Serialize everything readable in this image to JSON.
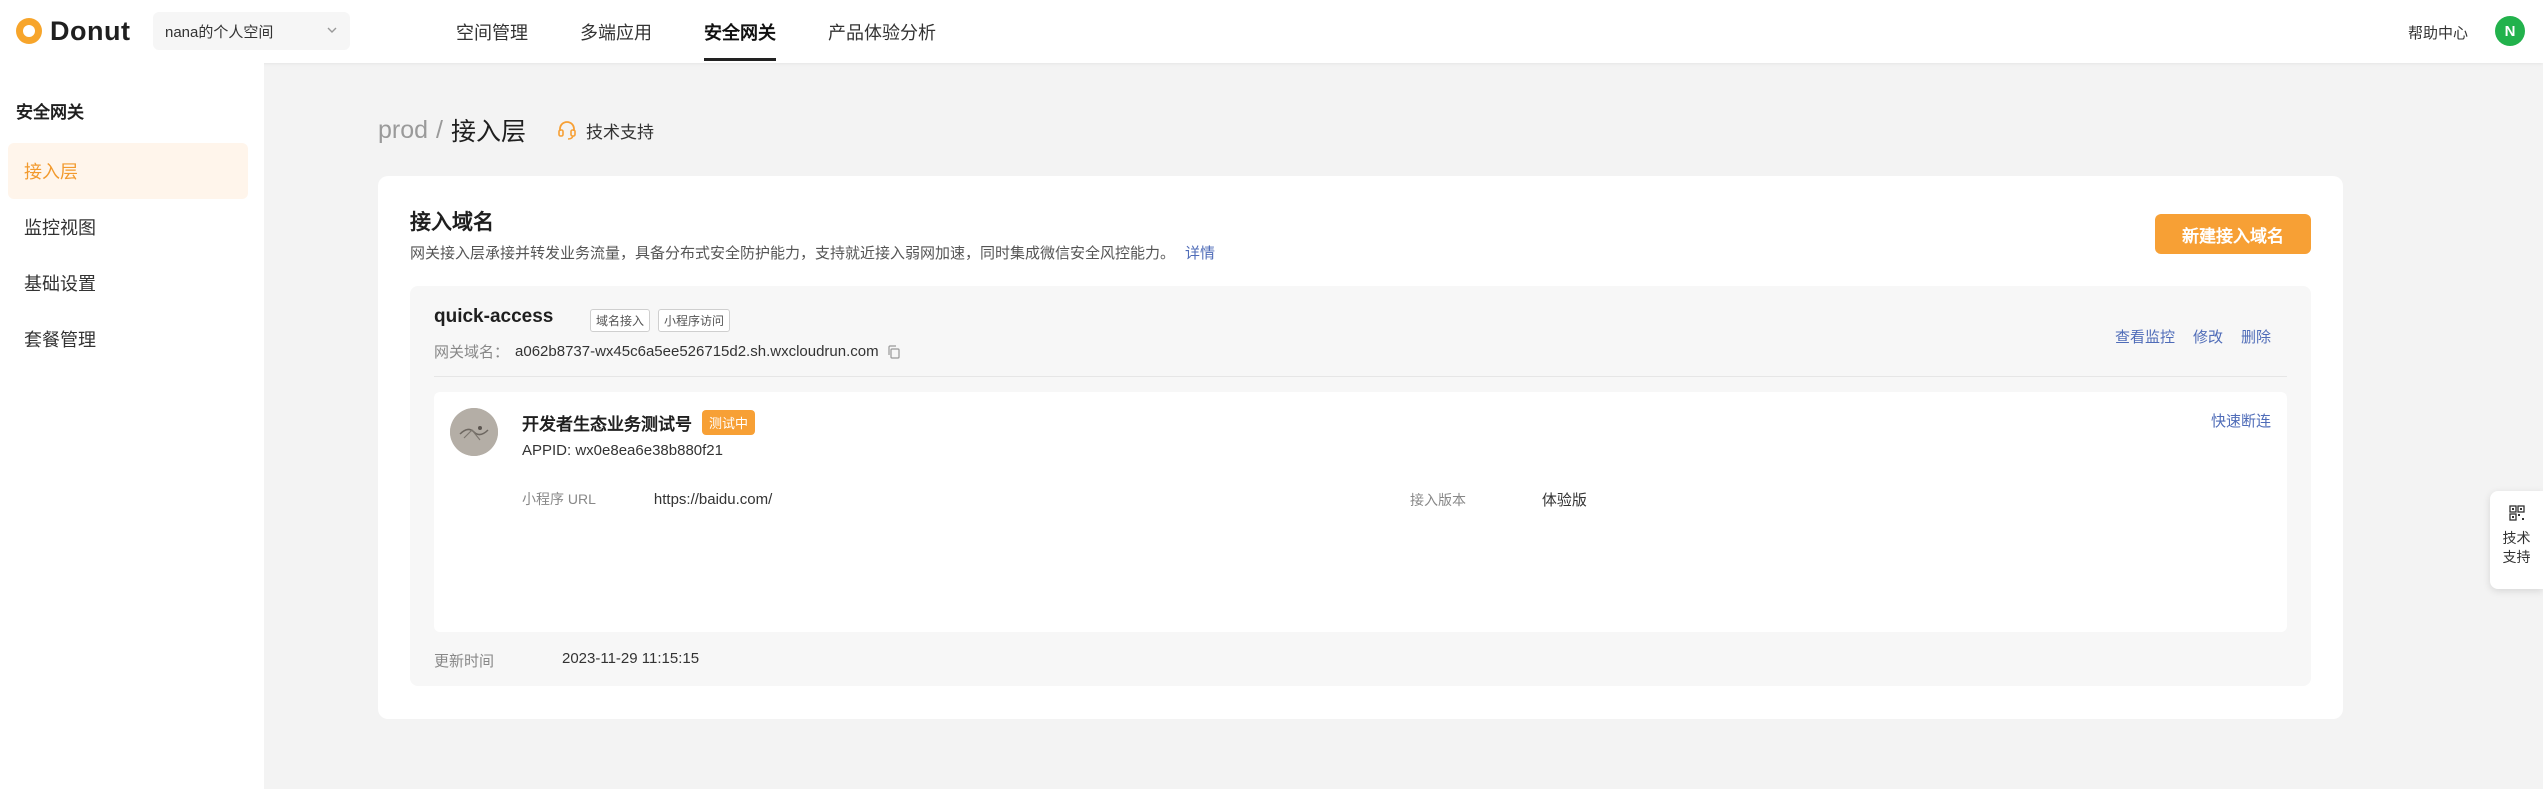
{
  "brand": {
    "name": "Donut",
    "color": "#f7a52b"
  },
  "workspace": {
    "selected": "nana的个人空间"
  },
  "nav": {
    "items": [
      {
        "label": "空间管理"
      },
      {
        "label": "多端应用"
      },
      {
        "label": "安全网关"
      },
      {
        "label": "产品体验分析"
      }
    ],
    "active": "安全网关"
  },
  "header": {
    "help": "帮助中心",
    "user_initial": "N",
    "user_color": "#22b24c"
  },
  "sidebar": {
    "title": "安全网关",
    "items": [
      {
        "label": "接入层",
        "active": true
      },
      {
        "label": "监控视图"
      },
      {
        "label": "基础设置"
      },
      {
        "label": "套餐管理"
      }
    ]
  },
  "breadcrumb": {
    "env": "prod",
    "separator": "/",
    "page": "接入层",
    "support": "技术支持"
  },
  "section": {
    "title": "接入域名",
    "description": "网关接入层承接并转发业务流量，具备分布式安全防护能力，支持就近接入弱网加速，同时集成微信安全风控能力。",
    "detail_link": "详情",
    "new_button": "新建接入域名"
  },
  "access": {
    "name": "quick-access",
    "tags": [
      "域名接入",
      "小程序访问"
    ],
    "domain_label": "网关域名：",
    "domain": "a062b8737-wx45c6a5ee526715d2.sh.wxcloudrun.com",
    "actions": [
      "查看监控",
      "修改",
      "删除"
    ],
    "miniprogram": {
      "name": "开发者生态业务测试号",
      "status": "测试中",
      "appid": "APPID: wx0e8ea6e38b880f21",
      "url_label": "小程序 URL",
      "url": "https://baidu.com/",
      "version_label": "接入版本",
      "version": "体验版",
      "disconnect": "快速断连"
    },
    "updated_label": "更新时间",
    "updated": "2023-11-29 11:15:15"
  },
  "float_support": {
    "label": "技术支持"
  },
  "colors": {
    "accent": "#f7a035",
    "link": "#4f6cb8"
  }
}
